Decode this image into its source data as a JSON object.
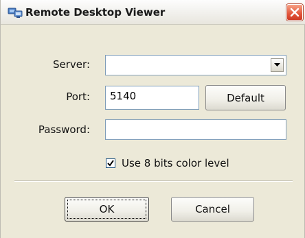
{
  "window": {
    "title": "Remote Desktop Viewer",
    "icon": "monitor-app-icon",
    "close_icon": "close-icon",
    "titlebar_color": "#f1f0ec",
    "background_color": "#ece9d8",
    "close_color": "#e2553b"
  },
  "form": {
    "server": {
      "label": "Server:",
      "value": ""
    },
    "port": {
      "label": "Port:",
      "value": "5140",
      "default_button": "Default"
    },
    "password": {
      "label": "Password:",
      "value": ""
    },
    "color_option": {
      "label": "Use 8 bits color level",
      "checked": true
    }
  },
  "buttons": {
    "ok": "OK",
    "cancel": "Cancel"
  }
}
